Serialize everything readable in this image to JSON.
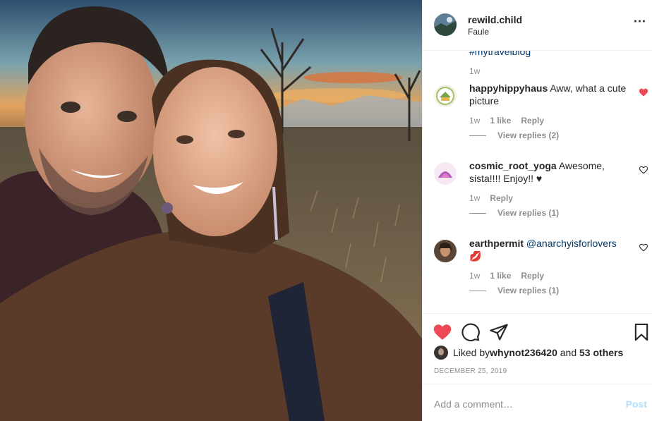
{
  "post": {
    "username": "rewild.child",
    "location": "Faule",
    "more_icon": "⋯",
    "photo": "selfie-couple-field-sunset"
  },
  "caption_tail": {
    "hashtag": "#mytravelblog",
    "time": "1w"
  },
  "comments": [
    {
      "user": "happyhippyhaus",
      "text": " Aww, what a cute picture",
      "time": "1w",
      "likes": "1 like",
      "reply": "Reply",
      "view_replies": "View replies (2)",
      "liked": true
    },
    {
      "user": "cosmic_root_yoga",
      "text": " Awesome, sista!!!! Enjoy!! ♥",
      "time": "1w",
      "likes": "",
      "reply": "Reply",
      "view_replies": "View replies (1)",
      "liked": false
    },
    {
      "user": "earthpermit",
      "mention": " @anarchyisforlovers",
      "emoji": "💋",
      "time": "1w",
      "likes": "1 like",
      "reply": "Reply",
      "view_replies": "View replies (1)",
      "liked": false
    }
  ],
  "actions": {
    "liked_by_prefix": "Liked by ",
    "liked_by_user": "whynot236420",
    "and": " and ",
    "others": "53 others",
    "date": "DECEMBER 25, 2019"
  },
  "add_comment": {
    "placeholder": "Add a comment…",
    "post_label": "Post"
  },
  "colors": {
    "like_red": "#ed4956",
    "link_blue": "#00376b",
    "post_disabled": "#b2dffc",
    "muted": "#8e8e8e"
  }
}
